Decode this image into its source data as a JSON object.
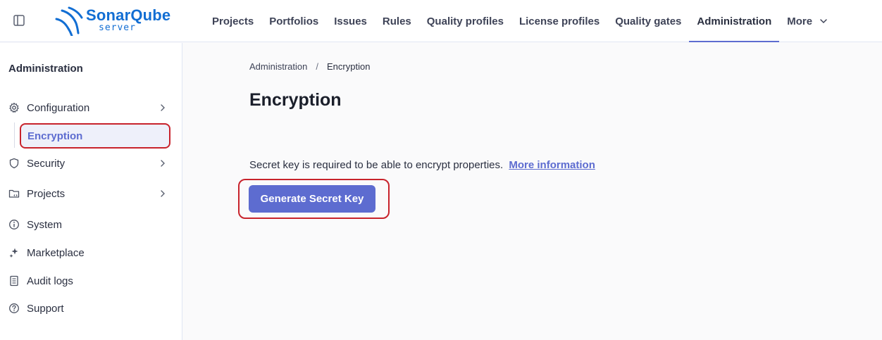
{
  "header": {
    "logo_title": "SonarQube",
    "logo_subtitle": "server",
    "nav": [
      {
        "label": "Projects"
      },
      {
        "label": "Portfolios"
      },
      {
        "label": "Issues"
      },
      {
        "label": "Rules"
      },
      {
        "label": "Quality profiles"
      },
      {
        "label": "License profiles"
      },
      {
        "label": "Quality gates"
      },
      {
        "label": "Administration",
        "active": true
      },
      {
        "label": "More"
      }
    ]
  },
  "sidebar": {
    "title": "Administration",
    "items": [
      {
        "label": "Configuration",
        "icon": "gear-icon"
      },
      {
        "label": "Encryption",
        "active": true
      },
      {
        "label": "Security",
        "icon": "shield-icon"
      },
      {
        "label": "Projects",
        "icon": "folder-icon"
      },
      {
        "label": "System",
        "icon": "info-icon"
      },
      {
        "label": "Marketplace",
        "icon": "marketplace-icon"
      },
      {
        "label": "Audit logs",
        "icon": "document-icon"
      },
      {
        "label": "Support",
        "icon": "help-icon"
      }
    ]
  },
  "main": {
    "breadcrumb": [
      "Administration",
      "Encryption"
    ],
    "title": "Encryption",
    "description": "Secret key is required to be able to encrypt properties.",
    "more_link": "More information",
    "generate_button": "Generate Secret Key"
  },
  "colors": {
    "accent": "#5d6cd0",
    "logo": "#126ed3",
    "highlight": "#c8232c"
  }
}
